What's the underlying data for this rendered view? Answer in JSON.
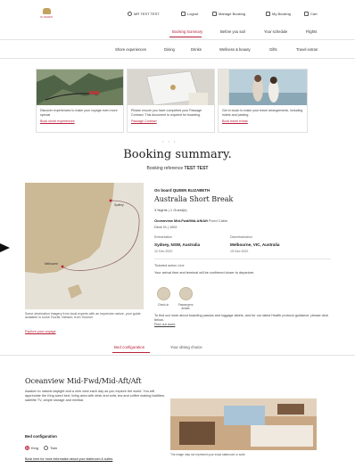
{
  "brand": {
    "logo_text": "CUNARD"
  },
  "header": {
    "user": "MR TEST TEST",
    "logout": "Logout",
    "manage": "Manage Booking",
    "my_booking": "My Booking",
    "cart": "Cart"
  },
  "main_nav": [
    "Booking Summary",
    "Before you sail",
    "Your schedule",
    "Flights"
  ],
  "sub_nav": [
    "Shore experiences",
    "Dining",
    "Drinks",
    "Wellness & beauty",
    "Gifts",
    "Travel extras"
  ],
  "cards": [
    {
      "text": "Discover experiences to make your voyage even more special",
      "link": "Book shore experiences"
    },
    {
      "text": "Please ensure you have completed your Passage Contract. This document is required for boarding.",
      "link": "Passage Contract"
    },
    {
      "text": "Get in touch to make your travel arrangements, including hotels and parking",
      "link": "Book travel extras"
    }
  ],
  "carousel_dots": "•  •  •",
  "summary": {
    "title": "Booking summary.",
    "ref_label": "Booking reference",
    "ref_value": "TEST TEST"
  },
  "map": {
    "note": "Some destination imagery from local experts with an imprecise nature, your guide available in some Tourist, Nielsen; from Tourism",
    "link": "Explore your voyage"
  },
  "trip": {
    "onboard": "On board QUEEN ELIZABETH",
    "title": "Australia Short Break",
    "nights": "3 Nights   |   1 Guest(s)",
    "cabin": "Oceanview Mid-Fwd/Mid-Aft/Aft",
    "cabin_sub": "Fixed Cabin",
    "deck": "Deck 01   |   1002",
    "embark_label": "Embarkation",
    "embark_port": "Sydney, NSW, Australia",
    "embark_date": "12 Dec 2022",
    "disembark_label": "Disembarkation",
    "disembark_port": "Melbourne, VIC, Australia",
    "disembark_date": "15 Dec 2022",
    "ticket_label": "Ticketed action Line",
    "ticket_text": "Your arrival time and terminal will be confirmed closer to departure.",
    "icon1_label": "Check-in",
    "icon2_label": "Passengers details",
    "info": "To find out more about boarding passes and luggage labels, and for our latest Health protocol guidance, please click below.",
    "info_link": "Find out more"
  },
  "tabs": [
    "Bed configuration",
    "Your dining choice"
  ],
  "stateroom": {
    "title": "Oceanview Mid-Fwd/Mid-Aft/Aft",
    "desc": "Awaken to natural daylight and a new view each day as you explore the world. You will appreciate the King sized bed, living area with desk and sofa, tea and coffee making facilities, satellite TV, ample storage and minibar.",
    "grid_label": "Bed configuration",
    "option1": "King",
    "option2": "Twin",
    "link": "Book here for more information about your stateroom & suites",
    "caption": "The image may not represent your exact stateroom or suite"
  }
}
